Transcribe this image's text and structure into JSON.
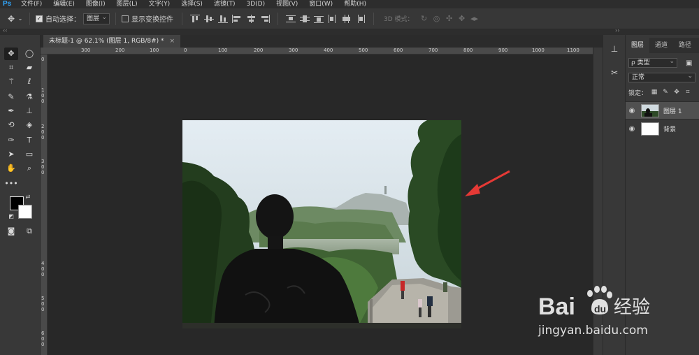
{
  "menubar": {
    "logo": "Ps",
    "items": [
      "文件(F)",
      "编辑(E)",
      "图像(I)",
      "图层(L)",
      "文字(Y)",
      "选择(S)",
      "滤镜(T)",
      "3D(D)",
      "视图(V)",
      "窗口(W)",
      "帮助(H)"
    ]
  },
  "options": {
    "auto_select_label": "自动选择：",
    "auto_select_target": "图层",
    "show_transform_label": "显示变换控件",
    "mode_3d_label": "3D 模式："
  },
  "document": {
    "tab_title": "未标题-1 @ 62.1% (图层 1, RGB/8#) *",
    "close_glyph": "×"
  },
  "rulers": {
    "top_labels": [
      "300",
      "200",
      "100",
      "0",
      "100",
      "200",
      "300",
      "400",
      "500",
      "600",
      "700",
      "800",
      "900",
      "1000",
      "1100"
    ],
    "left_labels": [
      "0",
      "1",
      "0",
      "0",
      "2",
      "0",
      "0",
      "3",
      "0",
      "0",
      "4",
      "0",
      "0",
      "5",
      "0",
      "0",
      "6",
      "0",
      "0"
    ]
  },
  "layers_panel": {
    "tabs": [
      "图层",
      "通道",
      "路径"
    ],
    "filter_kind": "ρ 类型",
    "blend_mode": "正常",
    "lock_label": "锁定：",
    "layers": [
      {
        "name": "图层 1",
        "selected": true
      },
      {
        "name": "背景",
        "selected": false
      }
    ]
  },
  "watermark": {
    "brand": "Bai",
    "brand_suffix": "du",
    "brand_cn": "经验",
    "url": "jingyan.baidu.com"
  },
  "colors": {
    "foreground": "#000000",
    "background": "#ffffff",
    "annotation_arrow": "#e53935"
  }
}
